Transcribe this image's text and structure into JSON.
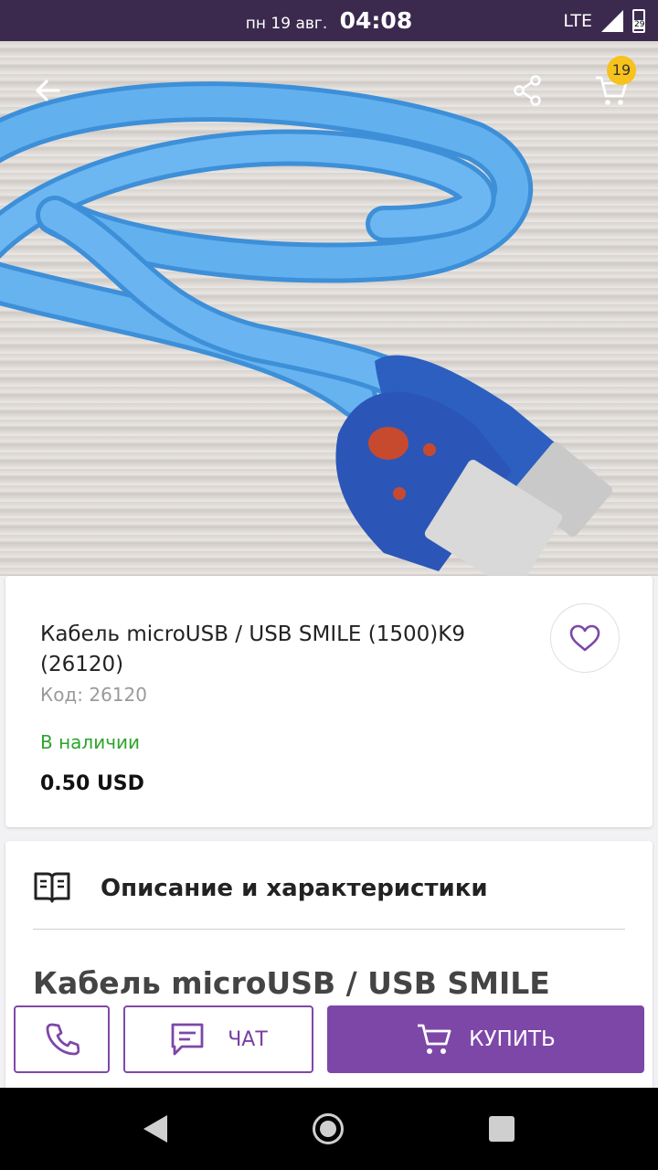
{
  "status_bar": {
    "date": "пн 19 авг.",
    "time": "04:08",
    "network": "LTE",
    "battery_level": "29"
  },
  "header": {
    "cart_count": "19"
  },
  "product": {
    "title": "Кабель microUSB / USB SMILE (1500)K9 (26120)",
    "code": "Код: 26120",
    "availability": "В наличии",
    "price": "0.50 USD"
  },
  "description": {
    "heading": "Описание и характеристики",
    "subtitle": "Кабель microUSB / USB SMILE"
  },
  "actions": {
    "chat_label": "ЧАТ",
    "buy_label": "КУПИТЬ"
  },
  "colors": {
    "accent": "#7d47a8",
    "status_bar": "#3b2a4e",
    "in_stock": "#2aa52a",
    "badge": "#f7c21c"
  },
  "icons": [
    "back-arrow-icon",
    "share-icon",
    "cart-icon",
    "heart-icon",
    "book-icon",
    "phone-icon",
    "chat-icon",
    "cart-icon"
  ]
}
